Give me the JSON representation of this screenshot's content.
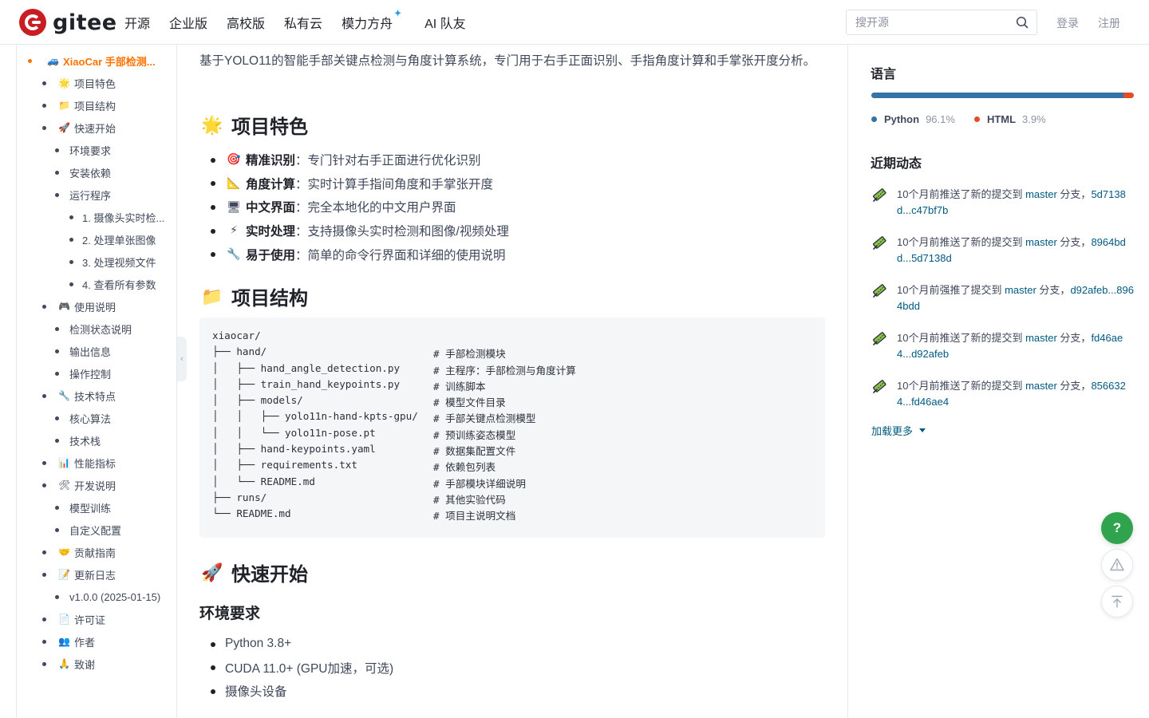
{
  "navbar": {
    "logo_text": "gitee",
    "links": [
      "开源",
      "企业版",
      "高校版",
      "私有云",
      "模力方舟"
    ],
    "spark": "✦",
    "ai_link": "AI 队友",
    "search_placeholder": "搜开源",
    "login": "登录",
    "register": "注册"
  },
  "toc": [
    {
      "text": "XiaoCar 手部检测...",
      "icon": "🚙",
      "level": 0,
      "active": true
    },
    {
      "text": "项目特色",
      "icon": "🌟",
      "level": 1
    },
    {
      "text": "项目结构",
      "icon": "📁",
      "level": 1
    },
    {
      "text": "快速开始",
      "icon": "🚀",
      "level": 1
    },
    {
      "text": "环境要求",
      "icon": "",
      "level": 2
    },
    {
      "text": "安装依赖",
      "icon": "",
      "level": 2
    },
    {
      "text": "运行程序",
      "icon": "",
      "level": 2
    },
    {
      "text": "1. 摄像头实时检...",
      "icon": "",
      "level": 3
    },
    {
      "text": "2. 处理单张图像",
      "icon": "",
      "level": 3
    },
    {
      "text": "3. 处理视频文件",
      "icon": "",
      "level": 3
    },
    {
      "text": "4. 查看所有参数",
      "icon": "",
      "level": 3
    },
    {
      "text": "使用说明",
      "icon": "🎮",
      "level": 1
    },
    {
      "text": "检测状态说明",
      "icon": "",
      "level": 2
    },
    {
      "text": "输出信息",
      "icon": "",
      "level": 2
    },
    {
      "text": "操作控制",
      "icon": "",
      "level": 2
    },
    {
      "text": "技术特点",
      "icon": "🔧",
      "level": 1
    },
    {
      "text": "核心算法",
      "icon": "",
      "level": 2
    },
    {
      "text": "技术栈",
      "icon": "",
      "level": 2
    },
    {
      "text": "性能指标",
      "icon": "📊",
      "level": 1
    },
    {
      "text": "开发说明",
      "icon": "🛠",
      "level": 1
    },
    {
      "text": "模型训练",
      "icon": "",
      "level": 2
    },
    {
      "text": "自定义配置",
      "icon": "",
      "level": 2
    },
    {
      "text": "贡献指南",
      "icon": "🤝",
      "level": 1
    },
    {
      "text": "更新日志",
      "icon": "📝",
      "level": 1
    },
    {
      "text": "v1.0.0 (2025-01-15)",
      "icon": "",
      "level": 2
    },
    {
      "text": "许可证",
      "icon": "📄",
      "level": 1
    },
    {
      "text": "作者",
      "icon": "👥",
      "level": 1
    },
    {
      "text": "致谢",
      "icon": "🙏",
      "level": 1
    }
  ],
  "content": {
    "intro": "基于YOLO11的智能手部关键点检测与角度计算系统，专门用于右手正面识别、手指角度计算和手掌张开度分析。",
    "features_heading": "项目特色",
    "features_emoji": "🌟",
    "features": [
      {
        "emoji": "🎯",
        "key": "精准识别",
        "sep": "：",
        "desc": "专门针对右手正面进行优化识别"
      },
      {
        "emoji": "📐",
        "key": "角度计算",
        "sep": "：",
        "desc": "实时计算手指间角度和手掌张开度"
      },
      {
        "emoji": "🖥",
        "key": "中文界面",
        "sep": "：",
        "desc": "完全本地化的中文用户界面"
      },
      {
        "emoji": "⚡",
        "key": "实时处理",
        "sep": "：",
        "desc": "支持摄像头实时检测和图像/视频处理"
      },
      {
        "emoji": "🔧",
        "key": "易于使用",
        "sep": "：",
        "desc": "简单的命令行界面和详细的使用说明"
      }
    ],
    "structure_heading": "项目结构",
    "structure_emoji": "📁",
    "code_lines": [
      {
        "tree": "xiaocar/",
        "comment": ""
      },
      {
        "tree": "├── hand/",
        "comment": "# 手部检测模块"
      },
      {
        "tree": "│   ├── hand_angle_detection.py",
        "comment": "# 主程序：手部检测与角度计算"
      },
      {
        "tree": "│   ├── train_hand_keypoints.py",
        "comment": "# 训练脚本"
      },
      {
        "tree": "│   ├── models/",
        "comment": "# 模型文件目录"
      },
      {
        "tree": "│   │   ├── yolo11n-hand-kpts-gpu/",
        "comment": "# 手部关键点检测模型"
      },
      {
        "tree": "│   │   └── yolo11n-pose.pt",
        "comment": "# 预训练姿态模型"
      },
      {
        "tree": "│   ├── hand-keypoints.yaml",
        "comment": "# 数据集配置文件"
      },
      {
        "tree": "│   ├── requirements.txt",
        "comment": "# 依赖包列表"
      },
      {
        "tree": "│   └── README.md",
        "comment": "# 手部模块详细说明"
      },
      {
        "tree": "├── runs/",
        "comment": "# 其他实验代码"
      },
      {
        "tree": "└── README.md",
        "comment": "# 项目主说明文档"
      }
    ],
    "quickstart_heading": "快速开始",
    "quickstart_emoji": "🚀",
    "env_heading": "环境要求",
    "env_items": [
      "Python 3.8+",
      "CUDA 11.0+ (GPU加速，可选)",
      "摄像头设备"
    ]
  },
  "right": {
    "lang_title": "语言",
    "languages": [
      {
        "name": "Python",
        "percent_label": "96.1%",
        "percent": 96.1,
        "color": "#3572a5"
      },
      {
        "name": "HTML",
        "percent_label": "3.9%",
        "percent": 3.9,
        "color": "#e34c26"
      }
    ],
    "activity_title": "近期动态",
    "events": [
      {
        "prefix": "10个月前推送了新的提交到 ",
        "branch": "master",
        "mid": " 分支，",
        "commit": "5d7138d...c47bf7b"
      },
      {
        "prefix": "10个月前推送了新的提交到 ",
        "branch": "master",
        "mid": " 分支，",
        "commit": "8964bdd...5d7138d"
      },
      {
        "prefix": "10个月前强推了提交到 ",
        "branch": "master",
        "mid": " 分支，",
        "commit": "d92afeb...8964bdd"
      },
      {
        "prefix": "10个月前推送了新的提交到 ",
        "branch": "master",
        "mid": " 分支，",
        "commit": "fd46ae4...d92afeb"
      },
      {
        "prefix": "10个月前推送了新的提交到 ",
        "branch": "master",
        "mid": " 分支，",
        "commit": "8566324...fd46ae4"
      }
    ],
    "load_more": "加载更多"
  },
  "fab": {
    "help": "?"
  },
  "colors": {
    "brand": "#c71d23",
    "accent": "#fe7300",
    "link": "#005980",
    "help": "#2fa34d"
  },
  "icons": {
    "search": "search-icon",
    "commit": "commit-icon",
    "warning": "warning-icon",
    "back_to_top": "back-to-top-icon",
    "collapse": "chevron-left-icon"
  }
}
